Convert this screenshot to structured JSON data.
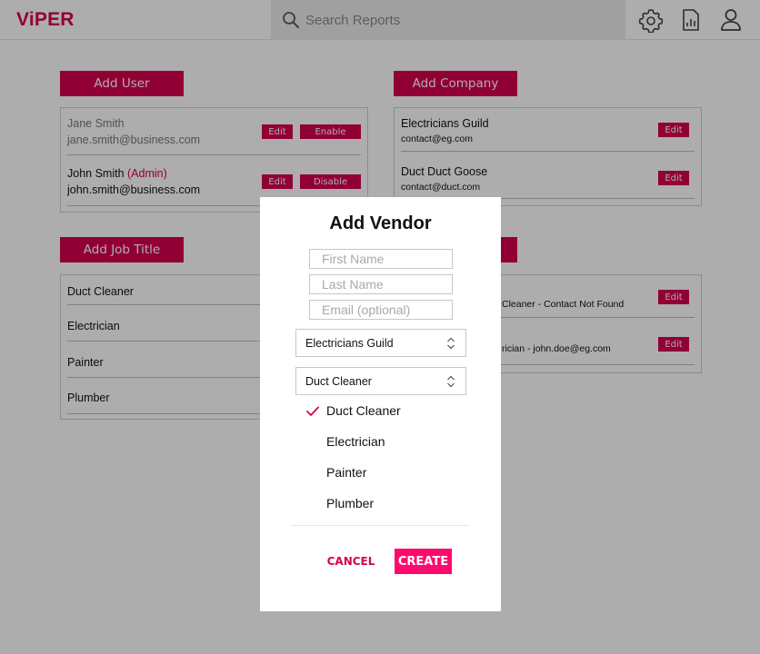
{
  "app": {
    "logo": "ViPER"
  },
  "search": {
    "placeholder": "Search Reports"
  },
  "header_icons": [
    "gear-icon",
    "report-icon",
    "user-icon"
  ],
  "colors": {
    "accent": "#d6004f",
    "create_button": "#ff0a6c"
  },
  "users": {
    "add_label": "Add User",
    "items": [
      {
        "name": "Jane Smith",
        "role": "",
        "email": "jane.smith@business.com",
        "edit_label": "Edit",
        "toggle_label": "Enable",
        "disabled": true
      },
      {
        "name": "John Smith",
        "role": "(Admin)",
        "email": "john.smith@business.com",
        "edit_label": "Edit",
        "toggle_label": "Disable",
        "disabled": false
      }
    ]
  },
  "companies": {
    "add_label": "Add Company",
    "items": [
      {
        "name": "Electricians Guild",
        "email": "contact@eg.com",
        "edit_label": "Edit"
      },
      {
        "name": "Duct Duct Goose",
        "email": "contact@duct.com",
        "edit_label": "Edit"
      }
    ]
  },
  "job_titles": {
    "add_label": "Add Job Title",
    "items": [
      "Duct Cleaner",
      "Electrician",
      "Painter",
      "Plumber"
    ]
  },
  "vendors": {
    "items": [
      {
        "text": "Cleaner - Contact Not Found",
        "edit_label": "Edit"
      },
      {
        "text": "rician - john.doe@eg.com",
        "edit_label": "Edit"
      }
    ]
  },
  "modal": {
    "title": "Add Vendor",
    "first_name_placeholder": "First Name",
    "last_name_placeholder": "Last Name",
    "email_placeholder": "Email (optional)",
    "company_value": "Electricians Guild",
    "job_title_value": "Duct Cleaner",
    "options": [
      "Duct Cleaner",
      "Electrician",
      "Painter",
      "Plumber"
    ],
    "selected_option": "Duct Cleaner",
    "cancel_label": "CANCEL",
    "create_label": "CREATE"
  }
}
